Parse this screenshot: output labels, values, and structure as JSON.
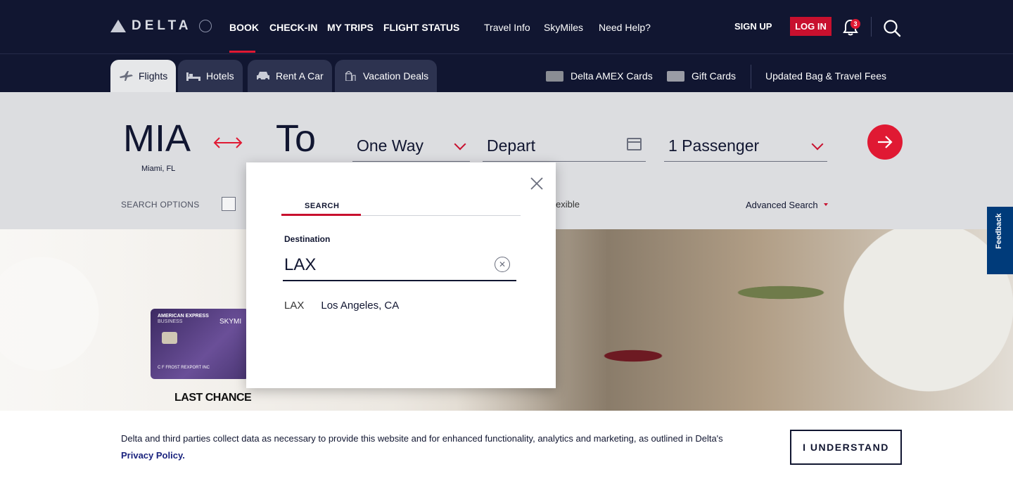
{
  "brand": {
    "logo_text": "DELTA"
  },
  "nav": {
    "book": "BOOK",
    "checkin": "CHECK-IN",
    "mytrips": "MY TRIPS",
    "flightstatus": "FLIGHT STATUS",
    "travelinfo": "Travel Info",
    "skymiles": "SkyMiles",
    "needhelp": "Need Help?",
    "signup": "SIGN UP",
    "login": "LOG IN",
    "notification_count": "3"
  },
  "subnav": {
    "tabs": [
      "Flights",
      "Hotels",
      "Rent A Car",
      "Vacation Deals"
    ],
    "amex": "Delta AMEX Cards",
    "giftcards": "Gift Cards",
    "bagfees": "Updated Bag & Travel Fees"
  },
  "booking": {
    "from_code": "MIA",
    "from_city": "Miami, FL",
    "to_code": "To",
    "trip_type": "One Way",
    "depart": "Depart",
    "passengers": "1 Passenger",
    "search_options": "SEARCH OPTIONS",
    "flexible_fragment": "exible",
    "advanced_search": "Advanced Search"
  },
  "promo": {
    "card_line1": "AMERICAN EXPRESS",
    "card_line2": "BUSINESS",
    "card_brand": "SKYMI",
    "card_name": "C F FROST\nREXPORT INC",
    "headline": "LAST CHANCE"
  },
  "feedback": "Feedback",
  "modal": {
    "tab": "SEARCH",
    "dest_label": "Destination",
    "dest_value": "LAX",
    "results": [
      {
        "code": "LAX",
        "city": "Los Angeles, CA"
      }
    ]
  },
  "cookie": {
    "text": "Delta and third parties collect data as necessary to provide this website and for enhanced functionality, analytics and marketing, as outlined in Delta's ",
    "link": "Privacy Policy.",
    "button": "I UNDERSTAND"
  },
  "colors": {
    "navy": "#111631",
    "red": "#e01933",
    "gray_bar": "#dcdde0"
  }
}
